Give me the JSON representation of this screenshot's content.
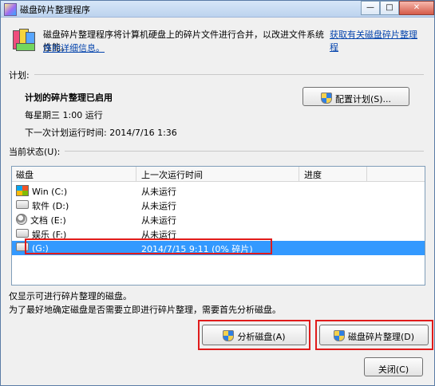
{
  "window": {
    "title": "磁盘碎片整理程序",
    "controls": {
      "minimize": "—",
      "maximize": "□",
      "close": "✕"
    }
  },
  "intro": {
    "description": "磁盘碎片整理程序将计算机硬盘上的碎片文件进行合并，以改进文件系统性能。",
    "link_part1": "获取有关磁盘碎片整理程",
    "link_part2": "序的详细信息。"
  },
  "schedule": {
    "section_label": "计划:",
    "status": "计划的碎片整理已启用",
    "run_time": "每星期三  1:00 运行",
    "next_run": "下一次计划运行时间: 2014/7/16 1:36",
    "configure_button": "配置计划(S)..."
  },
  "current_status": {
    "section_label": "当前状态(U):",
    "columns": [
      "磁盘",
      "上一次运行时间",
      "进度"
    ],
    "rows": [
      {
        "icon": "windows-drive-icon",
        "disk": "Win (C:)",
        "last_run": "从未运行",
        "progress": ""
      },
      {
        "icon": "drive-icon",
        "disk": "软件 (D:)",
        "last_run": "从未运行",
        "progress": ""
      },
      {
        "icon": "document-drive-icon",
        "disk": "文档 (E:)",
        "last_run": "从未运行",
        "progress": ""
      },
      {
        "icon": "drive-icon",
        "disk": "娱乐 (F:)",
        "last_run": "从未运行",
        "progress": ""
      },
      {
        "icon": "drive-icon",
        "disk": "(G:)",
        "last_run": "2014/7/15 9:11 (0% 碎片)",
        "progress": "",
        "selected": true
      }
    ]
  },
  "notes": {
    "line1": "仅显示可进行碎片整理的磁盘。",
    "line2": "为了最好地确定磁盘是否需要立即进行碎片整理，需要首先分析磁盘。"
  },
  "buttons": {
    "analyze": "分析磁盘(A)",
    "defragment": "磁盘碎片整理(D)",
    "close": "关闭(C)"
  },
  "colors": {
    "selection": "#3399ff",
    "highlight": "#e01b1b",
    "link": "#0645ad"
  }
}
